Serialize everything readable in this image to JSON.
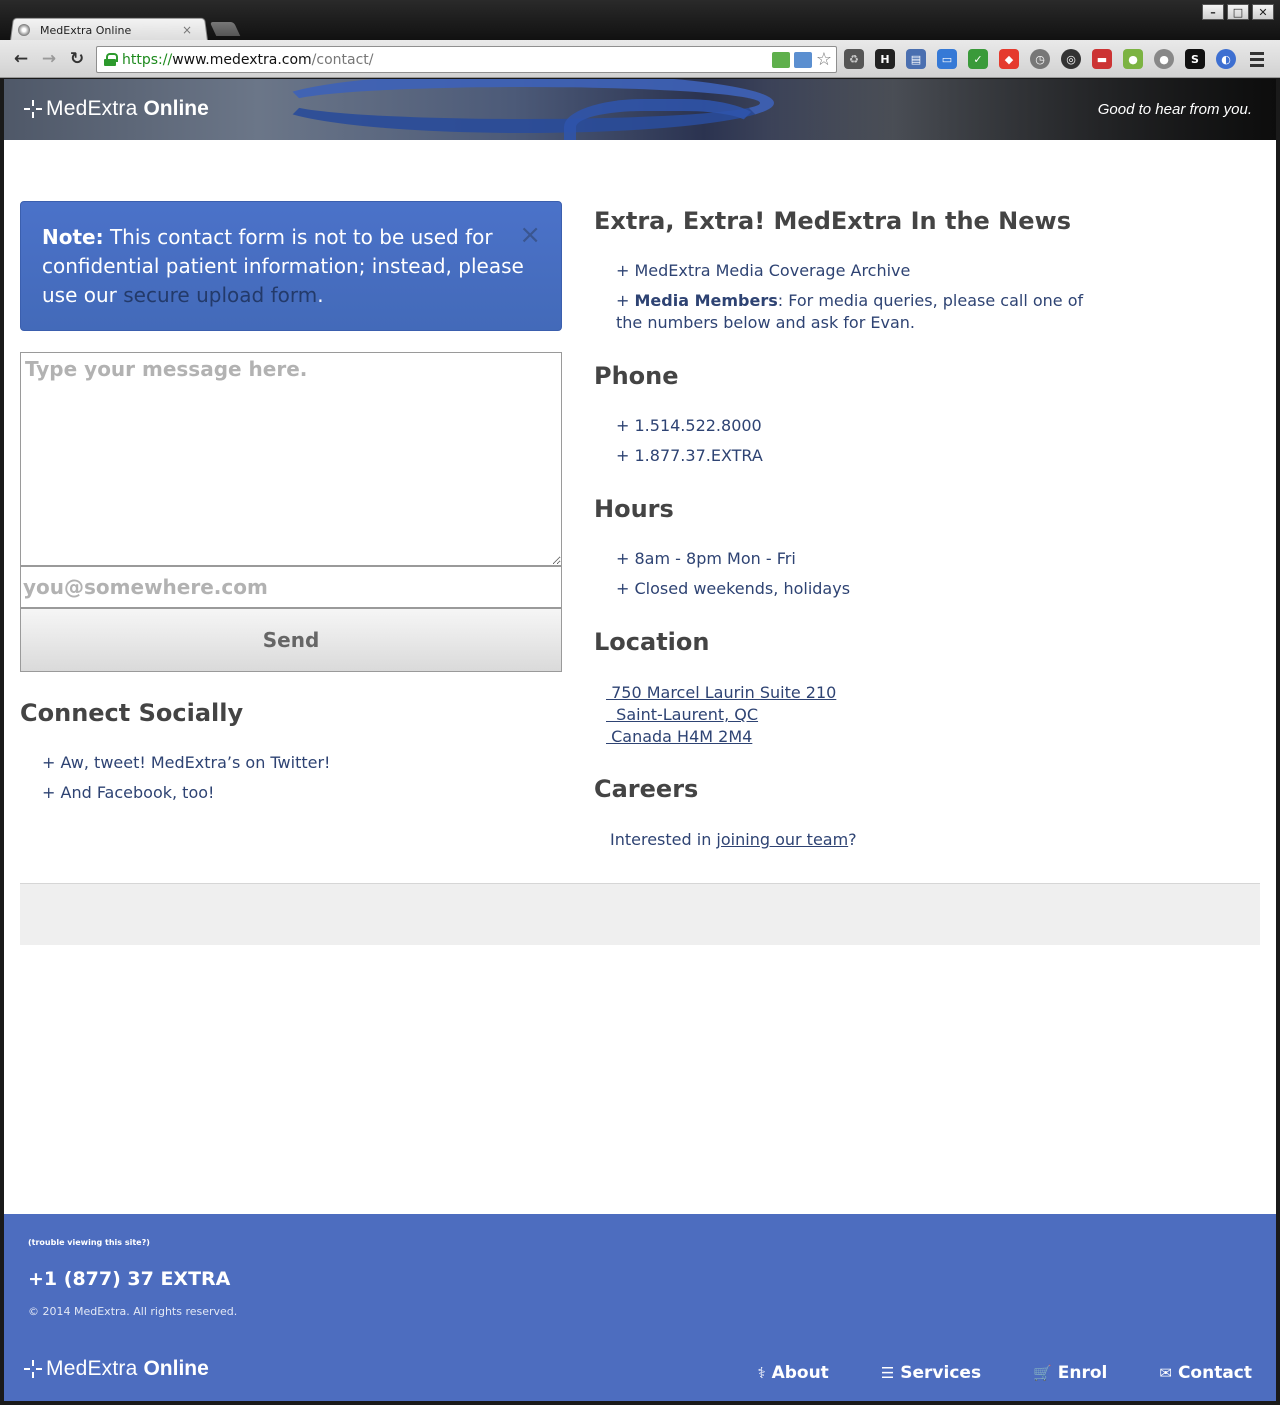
{
  "browser": {
    "tab_title": "MedExtra Online",
    "tab_close": "×",
    "url_scheme": "https://",
    "url_host": "www.medextra.com",
    "url_path": "/contact/",
    "window_controls": [
      "–",
      "□",
      "✕"
    ]
  },
  "header": {
    "brand_light": "MedExtra",
    "brand_bold": "Online",
    "tagline": "Good to hear from you."
  },
  "note": {
    "label": "Note:",
    "text": " This contact form is not to be used for confidential patient information; instead, please use our ",
    "link": "secure upload form",
    "end": ".",
    "close": "×"
  },
  "form": {
    "message_placeholder": "Type your message here.",
    "email_placeholder": "you@somewhere.com",
    "send_label": "Send"
  },
  "social": {
    "heading": "Connect Socially",
    "items": [
      "+ Aw, tweet! MedExtra’s on Twitter!",
      "+ And Facebook, too!"
    ]
  },
  "news": {
    "heading": "Extra, Extra! MedExtra In the News",
    "archive": "+ MedExtra Media Coverage Archive",
    "media_prefix": "+ ",
    "media_bold": "Media Members",
    "media_text": ": For media queries, please call one of the numbers below and ask for Evan."
  },
  "phone": {
    "heading": "Phone",
    "items": [
      "+ 1.514.522.8000",
      "+ 1.877.37.EXTRA"
    ]
  },
  "hours": {
    "heading": "Hours",
    "items": [
      "+ 8am - 8pm Mon - Fri",
      "+ Closed weekends, holidays"
    ]
  },
  "location": {
    "heading": "Location",
    "lines": [
      " 750 Marcel Laurin Suite 210",
      "  Saint-Laurent, QC",
      " Canada H4M 2M4"
    ]
  },
  "careers": {
    "heading": "Careers",
    "prefix": "Interested in ",
    "link": "joining our team",
    "suffix": "?"
  },
  "footer": {
    "trouble": "(trouble viewing this site?)",
    "phone": "+1 (877) 37 EXTRA",
    "copyright": "© 2014 MedExtra. All rights reserved.",
    "brand_light": "MedExtra",
    "brand_bold": "Online",
    "nav": [
      {
        "label": "About",
        "icon": "stethoscope-icon"
      },
      {
        "label": "Services",
        "icon": "list-icon"
      },
      {
        "label": "Enrol",
        "icon": "cart-icon"
      },
      {
        "label": "Contact",
        "icon": "envelope-icon"
      }
    ]
  }
}
